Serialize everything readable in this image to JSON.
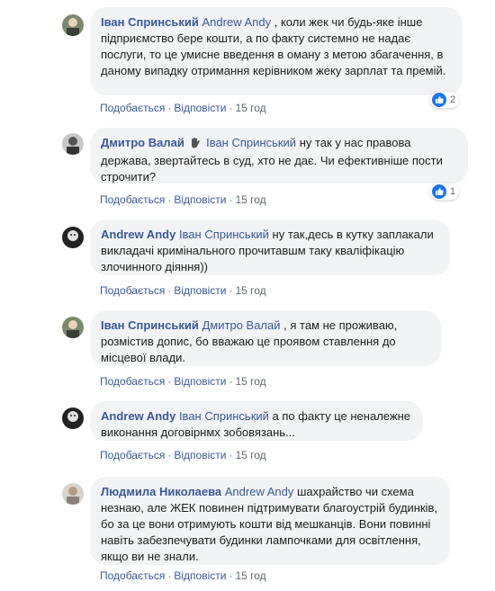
{
  "ui": {
    "like_label": "Подобається",
    "reply_label": "Відповісти",
    "separator": "·"
  },
  "comments": [
    {
      "author": "Іван Спринський",
      "mention": "Andrew Andy",
      "text": ", коли жек чи будь-яке інше підприємство бере кошти, а по факту системно не надає послуги, то це умисне введення в оману з метою збагачення, в даному випадку отримання керівником жеку зарплат та премій.",
      "time": "15 год",
      "reactions": "2"
    },
    {
      "author": "Дмитро Валай",
      "mention": "Іван Спринський",
      "text": "ну так у нас правова держава, звертайтесь в суд, хто не дає. Чи ефективніше пости строчити?",
      "time": "15 год",
      "reactions": "1"
    },
    {
      "author": "Andrew Andy",
      "mention": "Іван Спринський",
      "text": "ну так,десь в кутку заплакали викладачі кримінального прочитавшм таку кваліфікацію злочинного діяння))",
      "time": "15 год"
    },
    {
      "author": "Іван Спринський",
      "mention": "Дмитро Валай",
      "text": ", я там не проживаю, розмістив допис, бо вважаю це проявом ставлення до місцевої влади.",
      "time": "15 год"
    },
    {
      "author": "Andrew Andy",
      "mention": "Іван Спринський",
      "text": "а по факту це неналежне виконання договірнмх зобовязань...",
      "time": "15 год"
    },
    {
      "author": "Людмила Николаева",
      "mention": "Andrew Andy",
      "text": "шахрайство чи схема незнаю, але ЖЕК повинен підтримувати благоустрій будинків, бо за це вони отримують кошти від мешканців. Вони повинні навіть забезпечувати будинки лампочками для освітлення, якщо ви не знали.",
      "time": "15 год"
    }
  ]
}
